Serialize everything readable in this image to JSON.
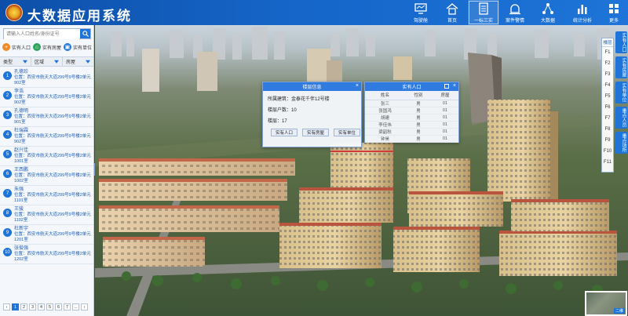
{
  "header": {
    "title": "大数据应用系统",
    "nav": [
      {
        "label": "驾驶舱",
        "icon": "monitor-icon"
      },
      {
        "label": "首页",
        "icon": "home-icon"
      },
      {
        "label": "一标三实",
        "icon": "document-icon"
      },
      {
        "label": "案件警情",
        "icon": "alarm-icon"
      },
      {
        "label": "大数据",
        "icon": "network-icon"
      },
      {
        "label": "统计分析",
        "icon": "bar-chart-icon"
      },
      {
        "label": "更多",
        "icon": "grid-icon"
      }
    ]
  },
  "left": {
    "search_placeholder": "请输入人口姓名/身份证号",
    "actions": [
      "实有人口",
      "实有房屋",
      "实有单位"
    ],
    "filters": [
      "类型",
      "区域",
      "房屋"
    ],
    "people": [
      {
        "name": "孔德珍",
        "addr": "位置：西安市航天大道299号9号楼2单元902室"
      },
      {
        "name": "李浩",
        "addr": "位置：西安市航天大道299号9号楼2单元902室"
      },
      {
        "name": "孔德明",
        "addr": "位置：西安市航天大道299号9号楼2单元901室"
      },
      {
        "name": "杜瑞霖",
        "addr": "位置：西安市航天大道299号9号楼2单元902室"
      },
      {
        "name": "赵兴佳",
        "addr": "位置：西安市航天大道299号9号楼2单元1001室"
      },
      {
        "name": "王西鹏",
        "addr": "位置：西安市航天大道299号9号楼2单元1002室"
      },
      {
        "name": "朱强",
        "addr": "位置：西安市航天大道299号9号楼2单元1101室"
      },
      {
        "name": "王骏",
        "addr": "位置：西安市航天大道299号9号楼2单元1102室"
      },
      {
        "name": "杜新宇",
        "addr": "位置：西安市航天大道299号9号楼2单元1201室"
      },
      {
        "name": "张俊强",
        "addr": "位置：西安市航天大道299号9号楼2单元1202室"
      }
    ],
    "pages": [
      "1",
      "2",
      "3",
      "4",
      "5",
      "6",
      "7",
      "..."
    ]
  },
  "building_popup": {
    "title": "楼层信息",
    "address": "所属建筑：金泰花千伴12号楼",
    "households": "楼层户数：10",
    "floor": "楼层：17",
    "buttons": [
      "实有人口",
      "实有房屋",
      "实有单位"
    ]
  },
  "population_popup": {
    "title": "实有人口",
    "columns": [
      "姓名",
      "性别",
      "房屋"
    ],
    "rows": [
      [
        "张三",
        "男",
        "01"
      ],
      [
        "张国鸿",
        "男",
        "01"
      ],
      [
        "胡建",
        "男",
        "01"
      ],
      [
        "李佳伟",
        "男",
        "01"
      ],
      [
        "梁韶秋",
        "男",
        "01"
      ],
      [
        "钟昊",
        "男",
        "01"
      ]
    ]
  },
  "floors": {
    "header": "楼层",
    "items": [
      "F1",
      "F2",
      "F3",
      "F4",
      "F5",
      "F6",
      "F7",
      "F8",
      "F9",
      "F10",
      "F11"
    ]
  },
  "right_tabs": [
    "实有人口",
    "实有房屋",
    "实有单位",
    "重点人员",
    "重点场所"
  ],
  "minimap": {
    "label": "二维"
  },
  "colors": {
    "header": "#1565c8",
    "accent": "#1e74d8",
    "popup_header": "#2f7be0"
  }
}
